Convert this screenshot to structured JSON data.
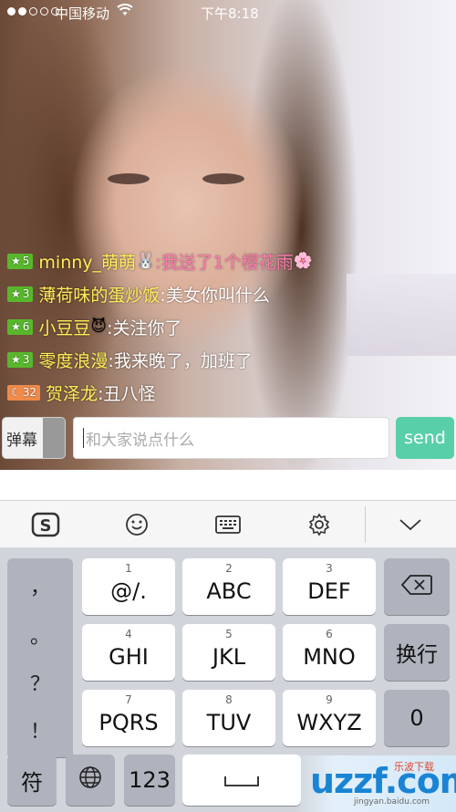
{
  "status_bar": {
    "carrier": "中国移动",
    "time": "下午8:18"
  },
  "chat": {
    "messages": [
      {
        "badge": "5",
        "badge_color": "green",
        "badge_icon": "star-icon",
        "user": "minny_萌萌",
        "emoji": "🐰",
        "text": ":我送了1个樱花雨",
        "text_color": "pink",
        "trail_emoji": "🌸"
      },
      {
        "badge": "3",
        "badge_color": "green",
        "badge_icon": "star-icon",
        "user": "薄荷味的蛋炒饭",
        "emoji": "",
        "text": ":美女你叫什么",
        "text_color": "white",
        "trail_emoji": ""
      },
      {
        "badge": "6",
        "badge_color": "green",
        "badge_icon": "star-icon",
        "user": "小豆豆",
        "emoji": "😈",
        "text": ":关注你了",
        "text_color": "white",
        "trail_emoji": ""
      },
      {
        "badge": "3",
        "badge_color": "green",
        "badge_icon": "star-icon",
        "user": "零度浪漫",
        "emoji": "",
        "text": ":我来晚了，加班了",
        "text_color": "white",
        "trail_emoji": ""
      },
      {
        "badge": "32",
        "badge_color": "orange",
        "badge_icon": "moon-icon",
        "user": "贺泽龙",
        "emoji": "",
        "text": ":丑八怪",
        "text_color": "white",
        "trail_emoji": ""
      }
    ]
  },
  "input_bar": {
    "danmu_label": "弹幕",
    "placeholder": "和大家说点什么",
    "send_label": "send"
  },
  "keyboard": {
    "toolbar_icons": [
      "sogou-logo-icon",
      "emoji-smile-icon",
      "keyboard-icon",
      "settings-gear-icon",
      "collapse-chevron-icon"
    ],
    "punctuation": [
      "，",
      "。",
      "？",
      "！"
    ],
    "keys": [
      {
        "num": "1",
        "label": "@/."
      },
      {
        "num": "2",
        "label": "ABC"
      },
      {
        "num": "3",
        "label": "DEF"
      },
      {
        "num": "4",
        "label": "GHI"
      },
      {
        "num": "5",
        "label": "JKL"
      },
      {
        "num": "6",
        "label": "MNO"
      },
      {
        "num": "7",
        "label": "PQRS"
      },
      {
        "num": "8",
        "label": "TUV"
      },
      {
        "num": "9",
        "label": "WXYZ"
      }
    ],
    "delete_icon": "backspace-icon",
    "return_label": "换行",
    "zero_label": "0",
    "symbols_label": "符",
    "globe_icon": "globe-icon",
    "numbers_label": "123",
    "space_icon": "space-bar-icon"
  },
  "watermark": {
    "logo": "uzzf.com",
    "tagline": "乐波下载",
    "subtext": "jingyan.baidu.com"
  }
}
